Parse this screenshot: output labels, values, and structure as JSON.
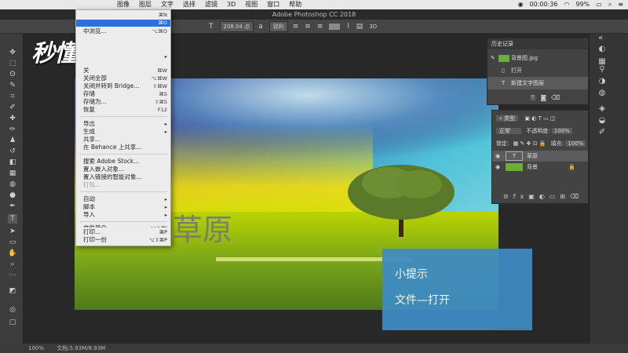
{
  "menubar": {
    "items": [
      "图像",
      "图层",
      "文字",
      "选择",
      "滤镜",
      "3D",
      "视图",
      "窗口",
      "帮助"
    ],
    "time": "00:00:36",
    "battery": "99%"
  },
  "window": {
    "title": "Adobe Photoshop CC 2018"
  },
  "options": {
    "font_size": "208.04 点",
    "antialias": "锐利"
  },
  "watermark": {
    "text": "秒懂视频"
  },
  "file_menu": {
    "items": [
      {
        "label": "",
        "shortcut": "⌘N"
      },
      {
        "label": "",
        "shortcut": "⌘O"
      },
      {
        "label": "中浏览...",
        "shortcut": "⌥⌘O"
      },
      {
        "label": "",
        "shortcut": ""
      },
      {
        "label": "关",
        "shortcut": "⌘W"
      },
      {
        "label": "关闭全部",
        "shortcut": "⌥⌘W"
      },
      {
        "label": "关闭并转到 Bridge...",
        "shortcut": "⇧⌘W"
      },
      {
        "label": "存储",
        "shortcut": "⌘S"
      },
      {
        "label": "存储为...",
        "shortcut": "⇧⌘S"
      },
      {
        "label": "恢复",
        "shortcut": "F12"
      },
      {
        "label": "导出",
        "shortcut": "▸"
      },
      {
        "label": "生成",
        "shortcut": "▸"
      },
      {
        "label": "共享...",
        "shortcut": ""
      },
      {
        "label": "在 Behance 上共享...",
        "shortcut": ""
      },
      {
        "label": "搜索 Adobe Stock...",
        "shortcut": ""
      },
      {
        "label": "置入嵌入对象...",
        "shortcut": ""
      },
      {
        "label": "置入链接的智能对象...",
        "shortcut": ""
      },
      {
        "label": "打包...",
        "shortcut": ""
      },
      {
        "label": "自动",
        "shortcut": "▸"
      },
      {
        "label": "脚本",
        "shortcut": "▸"
      },
      {
        "label": "导入",
        "shortcut": "▸"
      },
      {
        "label": "文件简介...",
        "shortcut": "⌥⇧⌘I"
      },
      {
        "label": "打印...",
        "shortcut": "⌘P"
      },
      {
        "label": "打印一份",
        "shortcut": "⌥⇧⌘P"
      }
    ]
  },
  "canvas": {
    "text": "草原"
  },
  "tip": {
    "title": "小提示",
    "text": "文件—打开"
  },
  "history": {
    "title": "历史记录",
    "items": [
      "背景图.jpg",
      "打开",
      "新建文字图层"
    ]
  },
  "layers": {
    "filter": "类型",
    "mode": "正常",
    "opacity_label": "不透明度:",
    "opacity": "100%",
    "lock_label": "锁定:",
    "fill_label": "填充:",
    "fill": "100%",
    "items": [
      "草原",
      "背景"
    ]
  },
  "status": {
    "zoom": "100%",
    "doc": "文档:5.93M/8.93M"
  }
}
